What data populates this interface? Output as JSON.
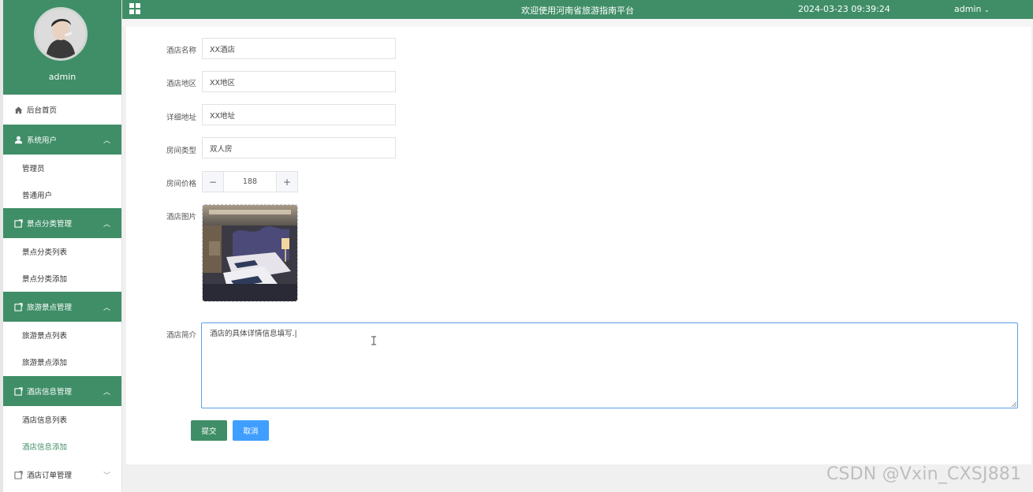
{
  "profile": {
    "name": "admin"
  },
  "menu": {
    "home": "后台首页",
    "system_users": "系统用户",
    "admins": "管理员",
    "normal_users": "普通用户",
    "scenic_category": "景点分类管理",
    "scenic_category_list": "景点分类列表",
    "scenic_category_add": "景点分类添加",
    "scenic_spot": "旅游景点管理",
    "scenic_spot_list": "旅游景点列表",
    "scenic_spot_add": "旅游景点添加",
    "hotel_info": "酒店信息管理",
    "hotel_info_list": "酒店信息列表",
    "hotel_info_add": "酒店信息添加",
    "hotel_orders": "酒店订单管理"
  },
  "header": {
    "title": "欢迎使用河南省旅游指南平台",
    "datetime": "2024-03-23 09:39:24",
    "user": "admin"
  },
  "form": {
    "hotel_name_label": "酒店名称",
    "hotel_name_value": "XX酒店",
    "region_label": "酒店地区",
    "region_value": "XX地区",
    "address_label": "详细地址",
    "address_value": "XX地址",
    "room_type_label": "房间类型",
    "room_type_value": "双人房",
    "price_label": "房间价格",
    "price_value": "188",
    "image_label": "酒店图片",
    "intro_label": "酒店简介",
    "intro_value": "酒店的具体详情信息填写.|",
    "submit": "提交",
    "cancel": "取消"
  },
  "watermark": "CSDN @Vxin_CXSJ881",
  "colors": {
    "brand_green": "#3f8e67",
    "cancel_blue": "#409eff",
    "textarea_focus": "#5aa0e8"
  }
}
